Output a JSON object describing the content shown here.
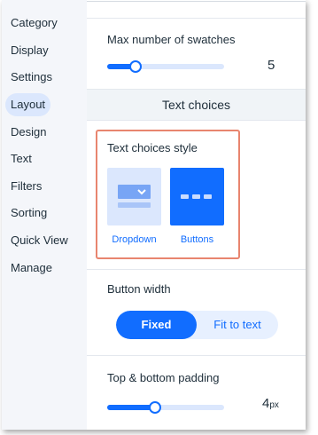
{
  "sidebar": {
    "items": [
      {
        "label": "Category"
      },
      {
        "label": "Display"
      },
      {
        "label": "Settings"
      },
      {
        "label": "Layout",
        "active": true
      },
      {
        "label": "Design"
      },
      {
        "label": "Text"
      },
      {
        "label": "Filters"
      },
      {
        "label": "Sorting"
      },
      {
        "label": "Quick View"
      },
      {
        "label": "Manage"
      }
    ]
  },
  "panel": {
    "swatches": {
      "label": "Max number of swatches",
      "value": "5",
      "slider_fraction": 0.24
    },
    "section_header": "Text choices",
    "text_choices_style": {
      "label": "Text choices style",
      "options": [
        {
          "label": "Dropdown",
          "selected": false,
          "icon": "dropdown-icon"
        },
        {
          "label": "Buttons",
          "selected": true,
          "icon": "buttons-icon"
        }
      ]
    },
    "button_width": {
      "label": "Button width",
      "options": [
        {
          "label": "Fixed",
          "selected": true
        },
        {
          "label": "Fit to text",
          "selected": false
        }
      ]
    },
    "padding": {
      "label": "Top & bottom padding",
      "value": "4",
      "unit": "px",
      "slider_fraction": 0.41
    }
  },
  "colors": {
    "accent": "#116dff",
    "accent_light": "#dbe7fd",
    "highlight_border": "#e8856f",
    "sidebar_bg": "#f4f6fa",
    "section_header_bg": "#f0f4f7"
  }
}
